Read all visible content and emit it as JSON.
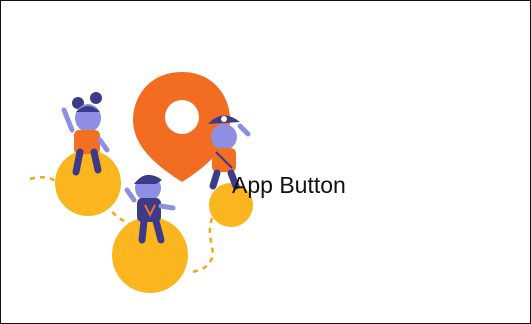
{
  "slide": {
    "button_label": "App Button"
  },
  "colors": {
    "pin": "#f26d21",
    "ball": "#fbb51f",
    "skin": "#8e8fe3",
    "shirt": "#f36f21",
    "pants": "#3d3a8a",
    "path": "#f3a51b"
  },
  "icons": [
    "location-pin-icon",
    "skull-icon"
  ]
}
